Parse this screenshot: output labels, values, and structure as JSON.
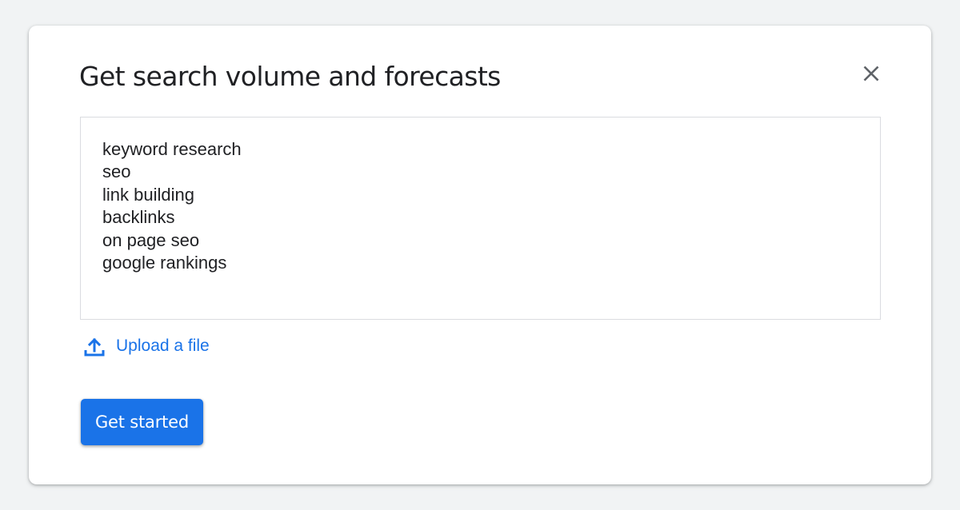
{
  "dialog": {
    "title": "Get search volume and forecasts",
    "close_icon": "close-icon",
    "keywords_value": "keyword research\nseo\nlink building\nbacklinks\non page seo\ngoogle rankings",
    "upload": {
      "icon": "upload-icon",
      "label": "Upload a file"
    },
    "primary_button_label": "Get started"
  },
  "colors": {
    "accent": "#1a73e8",
    "background": "#f1f3f4",
    "text": "#202124",
    "icon": "#5f6368"
  }
}
